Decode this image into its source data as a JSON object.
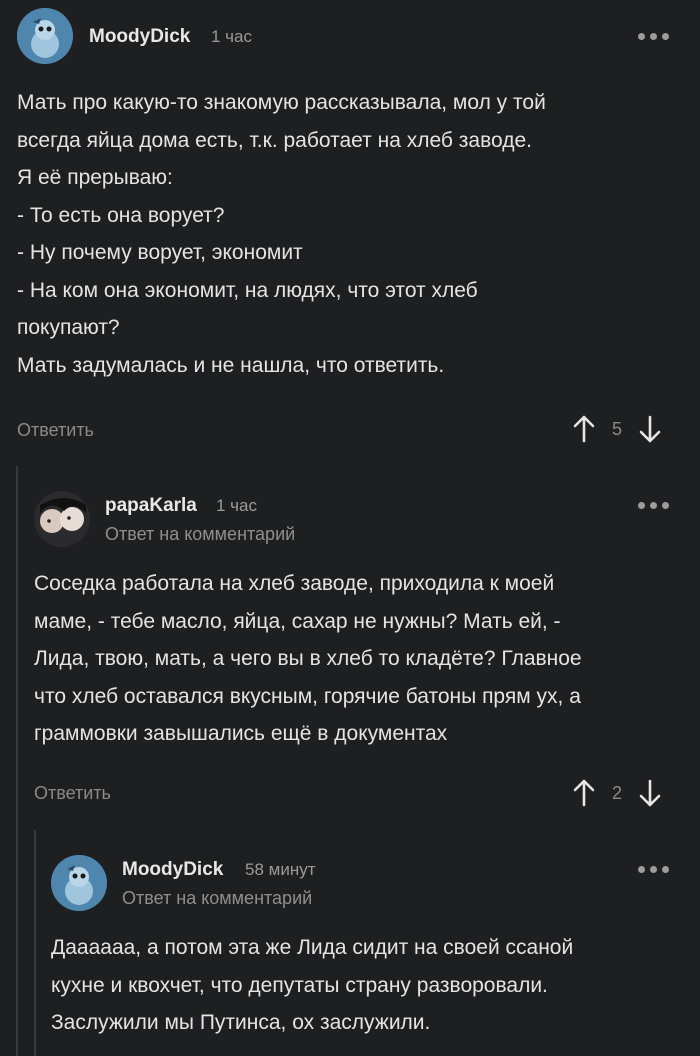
{
  "comments": [
    {
      "username": "MoodyDick",
      "time": "1 час",
      "lines": [
        "Мать про какую-то знакомую рассказывала, мол у той",
        "всегда яйца дома есть, т.к. работает на хлеб заводе.",
        "Я её прерываю:",
        "- То есть она ворует?",
        "- Ну почему ворует, экономит",
        "- На ком она экономит, на людях, что этот хлеб",
        "покупают?",
        "Мать задумалась и не нашла, что ответить."
      ],
      "reply_label": "Ответить",
      "score": "5"
    },
    {
      "username": "papaKarla",
      "time": "1 час",
      "reply_to": "Ответ на комментарий",
      "lines": [
        "Соседка работала на хлеб заводе, приходила к моей",
        "маме, - тебе масло, яйца, сахар не нужны? Мать ей, -",
        "Лида, твою, мать, а чего вы в хлеб то кладёте? Главное",
        "что хлеб оставался вкусным, горячие батоны прям ух, а",
        "граммовки завышались ещё в документах"
      ],
      "reply_label": "Ответить",
      "score": "2"
    },
    {
      "username": "MoodyDick",
      "time": "58 минут",
      "reply_to": "Ответ на комментарий",
      "lines": [
        "Даааааа, а потом эта же Лида сидит на своей ссаной",
        "кухне и квохчет, что депутаты страну разворовали.",
        "Заслужили мы Путинса, ох заслужили."
      ]
    }
  ],
  "icons": {
    "more": "more-dots-icon",
    "upvote": "arrow-up-icon",
    "downvote": "arrow-down-icon"
  },
  "colors": {
    "background": "#1e1f21",
    "text": "#e4e4e4",
    "muted": "#8a8a8a"
  }
}
